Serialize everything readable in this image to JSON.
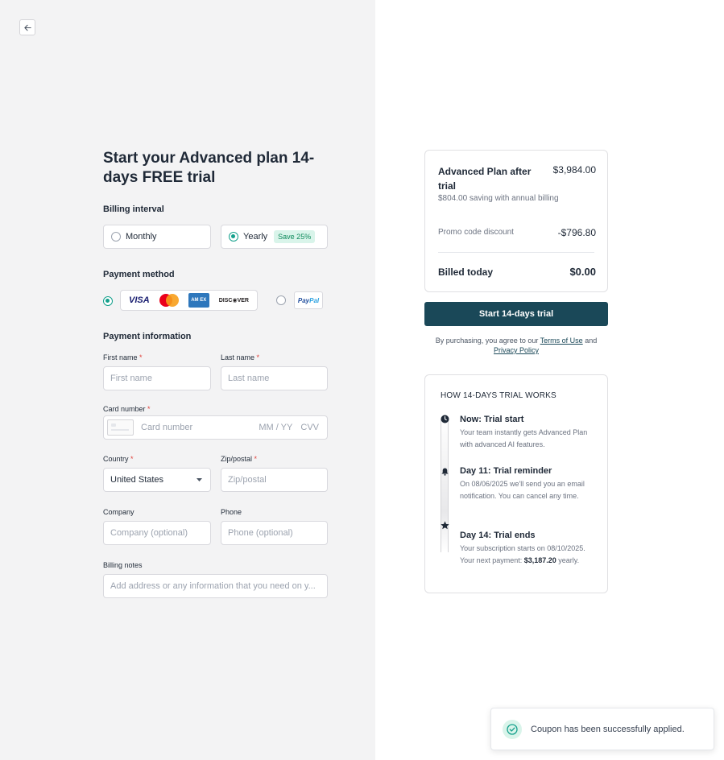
{
  "title": "Start your Advanced plan 14-days FREE trial",
  "billing": {
    "label": "Billing interval",
    "monthly": "Monthly",
    "yearly": "Yearly",
    "yearly_badge": "Save 25%",
    "selected": "Yearly"
  },
  "payment_method": {
    "label": "Payment method",
    "card_brands": [
      "VISA",
      "Mastercard",
      "AMEX",
      "DISCOVER"
    ],
    "visa": "VISA",
    "amex": "AM EX",
    "discover": "DISC◉VER",
    "paypal_pay": "Pay",
    "paypal_pal": "Pal",
    "selected": "card"
  },
  "payment_info": {
    "label": "Payment information",
    "first_name_label": "First name",
    "first_name_placeholder": "First name",
    "last_name_label": "Last name",
    "last_name_placeholder": "Last name",
    "card_number_label": "Card number",
    "card_number_placeholder": "Card number",
    "expiry_placeholder": "MM / YY",
    "cvv_placeholder": "CVV",
    "country_label": "Country",
    "country_value": "United States",
    "zip_label": "Zip/postal",
    "zip_placeholder": "Zip/postal",
    "company_label": "Company",
    "company_placeholder": "Company (optional)",
    "phone_label": "Phone",
    "phone_placeholder": "Phone (optional)",
    "notes_label": "Billing notes",
    "notes_placeholder": "Add address or any information that you need on y..."
  },
  "summary": {
    "plan_label": "Advanced Plan after trial",
    "plan_price": "$3,984.00",
    "saving_note": "$804.00 saving with annual billing",
    "promo_label": "Promo code discount",
    "promo_value": "-$796.80",
    "billed_label": "Billed today",
    "billed_value": "$0.00"
  },
  "cta": {
    "label": "Start 14-days trial"
  },
  "agreement": {
    "prefix": "By purchasing, you agree to our",
    "terms": "Terms of Use",
    "and": "and",
    "privacy": "Privacy Policy"
  },
  "how_it_works": {
    "title": "HOW 14-DAYS TRIAL WORKS",
    "steps": [
      {
        "title": "Now: Trial start",
        "text": "Your team instantly gets Advanced Plan with advanced AI features."
      },
      {
        "title": "Day 11: Trial reminder",
        "text": "On 08/06/2025 we'll send you an email notification. You can cancel any time."
      },
      {
        "title": "Day 14: Trial ends",
        "text_before": "Your subscription starts on 08/10/2025. Your next payment:",
        "amount": "$3,187.20",
        "text_after": "yearly."
      }
    ]
  },
  "toast": {
    "message": "Coupon has been successfully applied."
  },
  "colors": {
    "accent": "#14a08c",
    "cta": "#1a4858",
    "required": "#e0403a"
  }
}
